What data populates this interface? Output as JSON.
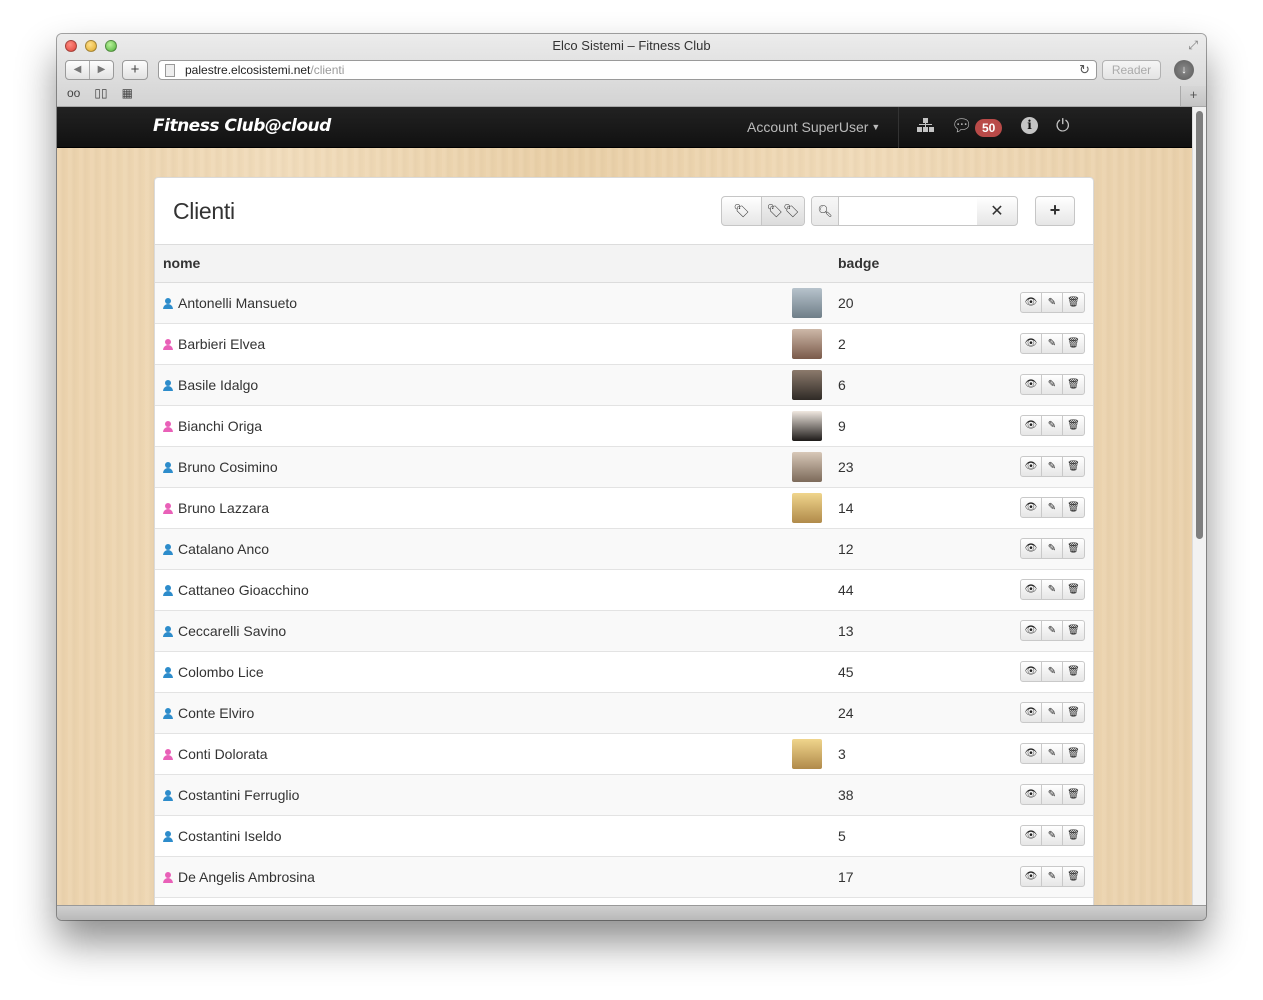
{
  "browser": {
    "window_title": "Elco Sistemi – Fitness Club",
    "url_host": "palestre.elcosistemi.net",
    "url_path": "/clienti",
    "reader_label": "Reader"
  },
  "app": {
    "brand": "Fitness Club@cloud",
    "account_menu": "Account SuperUser",
    "notifications_count": "50"
  },
  "page": {
    "title": "Clienti",
    "search_placeholder": ""
  },
  "table": {
    "columns": [
      "nome",
      "badge"
    ],
    "rows": [
      {
        "name": "Antonelli Mansueto",
        "gender": "m",
        "photo": true,
        "badge": "20"
      },
      {
        "name": "Barbieri Elvea",
        "gender": "f",
        "photo": true,
        "badge": "2"
      },
      {
        "name": "Basile Idalgo",
        "gender": "m",
        "photo": true,
        "badge": "6"
      },
      {
        "name": "Bianchi Origa",
        "gender": "f",
        "photo": true,
        "badge": "9"
      },
      {
        "name": "Bruno Cosimino",
        "gender": "m",
        "photo": true,
        "badge": "23"
      },
      {
        "name": "Bruno Lazzara",
        "gender": "f",
        "photo": true,
        "badge": "14"
      },
      {
        "name": "Catalano Anco",
        "gender": "m",
        "photo": false,
        "badge": "12"
      },
      {
        "name": "Cattaneo Gioacchino",
        "gender": "m",
        "photo": false,
        "badge": "44"
      },
      {
        "name": "Ceccarelli Savino",
        "gender": "m",
        "photo": false,
        "badge": "13"
      },
      {
        "name": "Colombo Lice",
        "gender": "m",
        "photo": false,
        "badge": "45"
      },
      {
        "name": "Conte Elviro",
        "gender": "m",
        "photo": false,
        "badge": "24"
      },
      {
        "name": "Conti Dolorata",
        "gender": "f",
        "photo": true,
        "badge": "3"
      },
      {
        "name": "Costantini Ferruglio",
        "gender": "m",
        "photo": false,
        "badge": "38"
      },
      {
        "name": "Costantini Iseldo",
        "gender": "m",
        "photo": false,
        "badge": "5"
      },
      {
        "name": "De Angelis Ambrosina",
        "gender": "f",
        "photo": false,
        "badge": "17"
      },
      {
        "name": "",
        "gender": "m",
        "photo": false,
        "badge": ""
      }
    ]
  },
  "colors": {
    "male": "#2d8ccb",
    "female": "#e960b8",
    "badge_red": "#b94a48"
  },
  "icons": {
    "row_actions": [
      "eye-icon",
      "pencil-icon",
      "trash-icon"
    ],
    "toolbar": [
      "tag-icon",
      "tags-icon",
      "search-icon",
      "close-icon",
      "plus-icon"
    ],
    "navbar": [
      "sitemap-icon",
      "chat-icon",
      "info-icon",
      "power-icon"
    ]
  }
}
